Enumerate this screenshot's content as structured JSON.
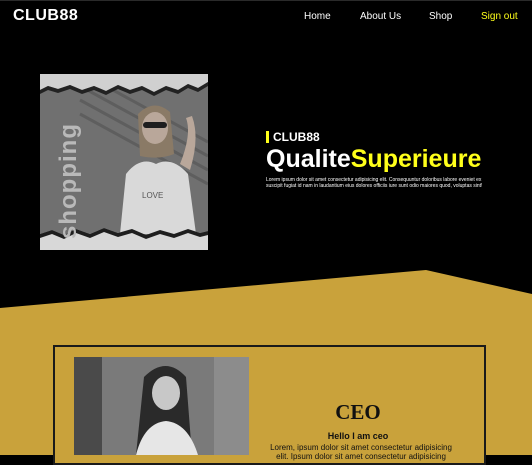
{
  "nav": {
    "logo": "CLUB88",
    "links": [
      {
        "label": "Home"
      },
      {
        "label": "About Us"
      },
      {
        "label": "Shop"
      },
      {
        "label": "Sign out"
      }
    ]
  },
  "hero": {
    "image_text": "shopping",
    "brand": "CLUB88",
    "title_white": "Qualite",
    "title_yellow": "Superieure",
    "body": "Lorem ipsum dolor sit amet consectetur adipisicing elit. Consequuntur doloribus labore eveniet ex suscipit fugiat id nam in laudantium eius dolores officiis iure sunt odio maiores quod, voluptas sint!"
  },
  "about": {
    "title": "CEO",
    "greeting": "Hello I am ceo",
    "body": "Lorem, ipsum dolor sit amet consectetur adipisicing elit. Ipsum dolor sit amet consectetur adipisicing"
  },
  "colors": {
    "background": "#000000",
    "accent_yellow": "#ffff1a",
    "gold": "#c9a23b"
  }
}
